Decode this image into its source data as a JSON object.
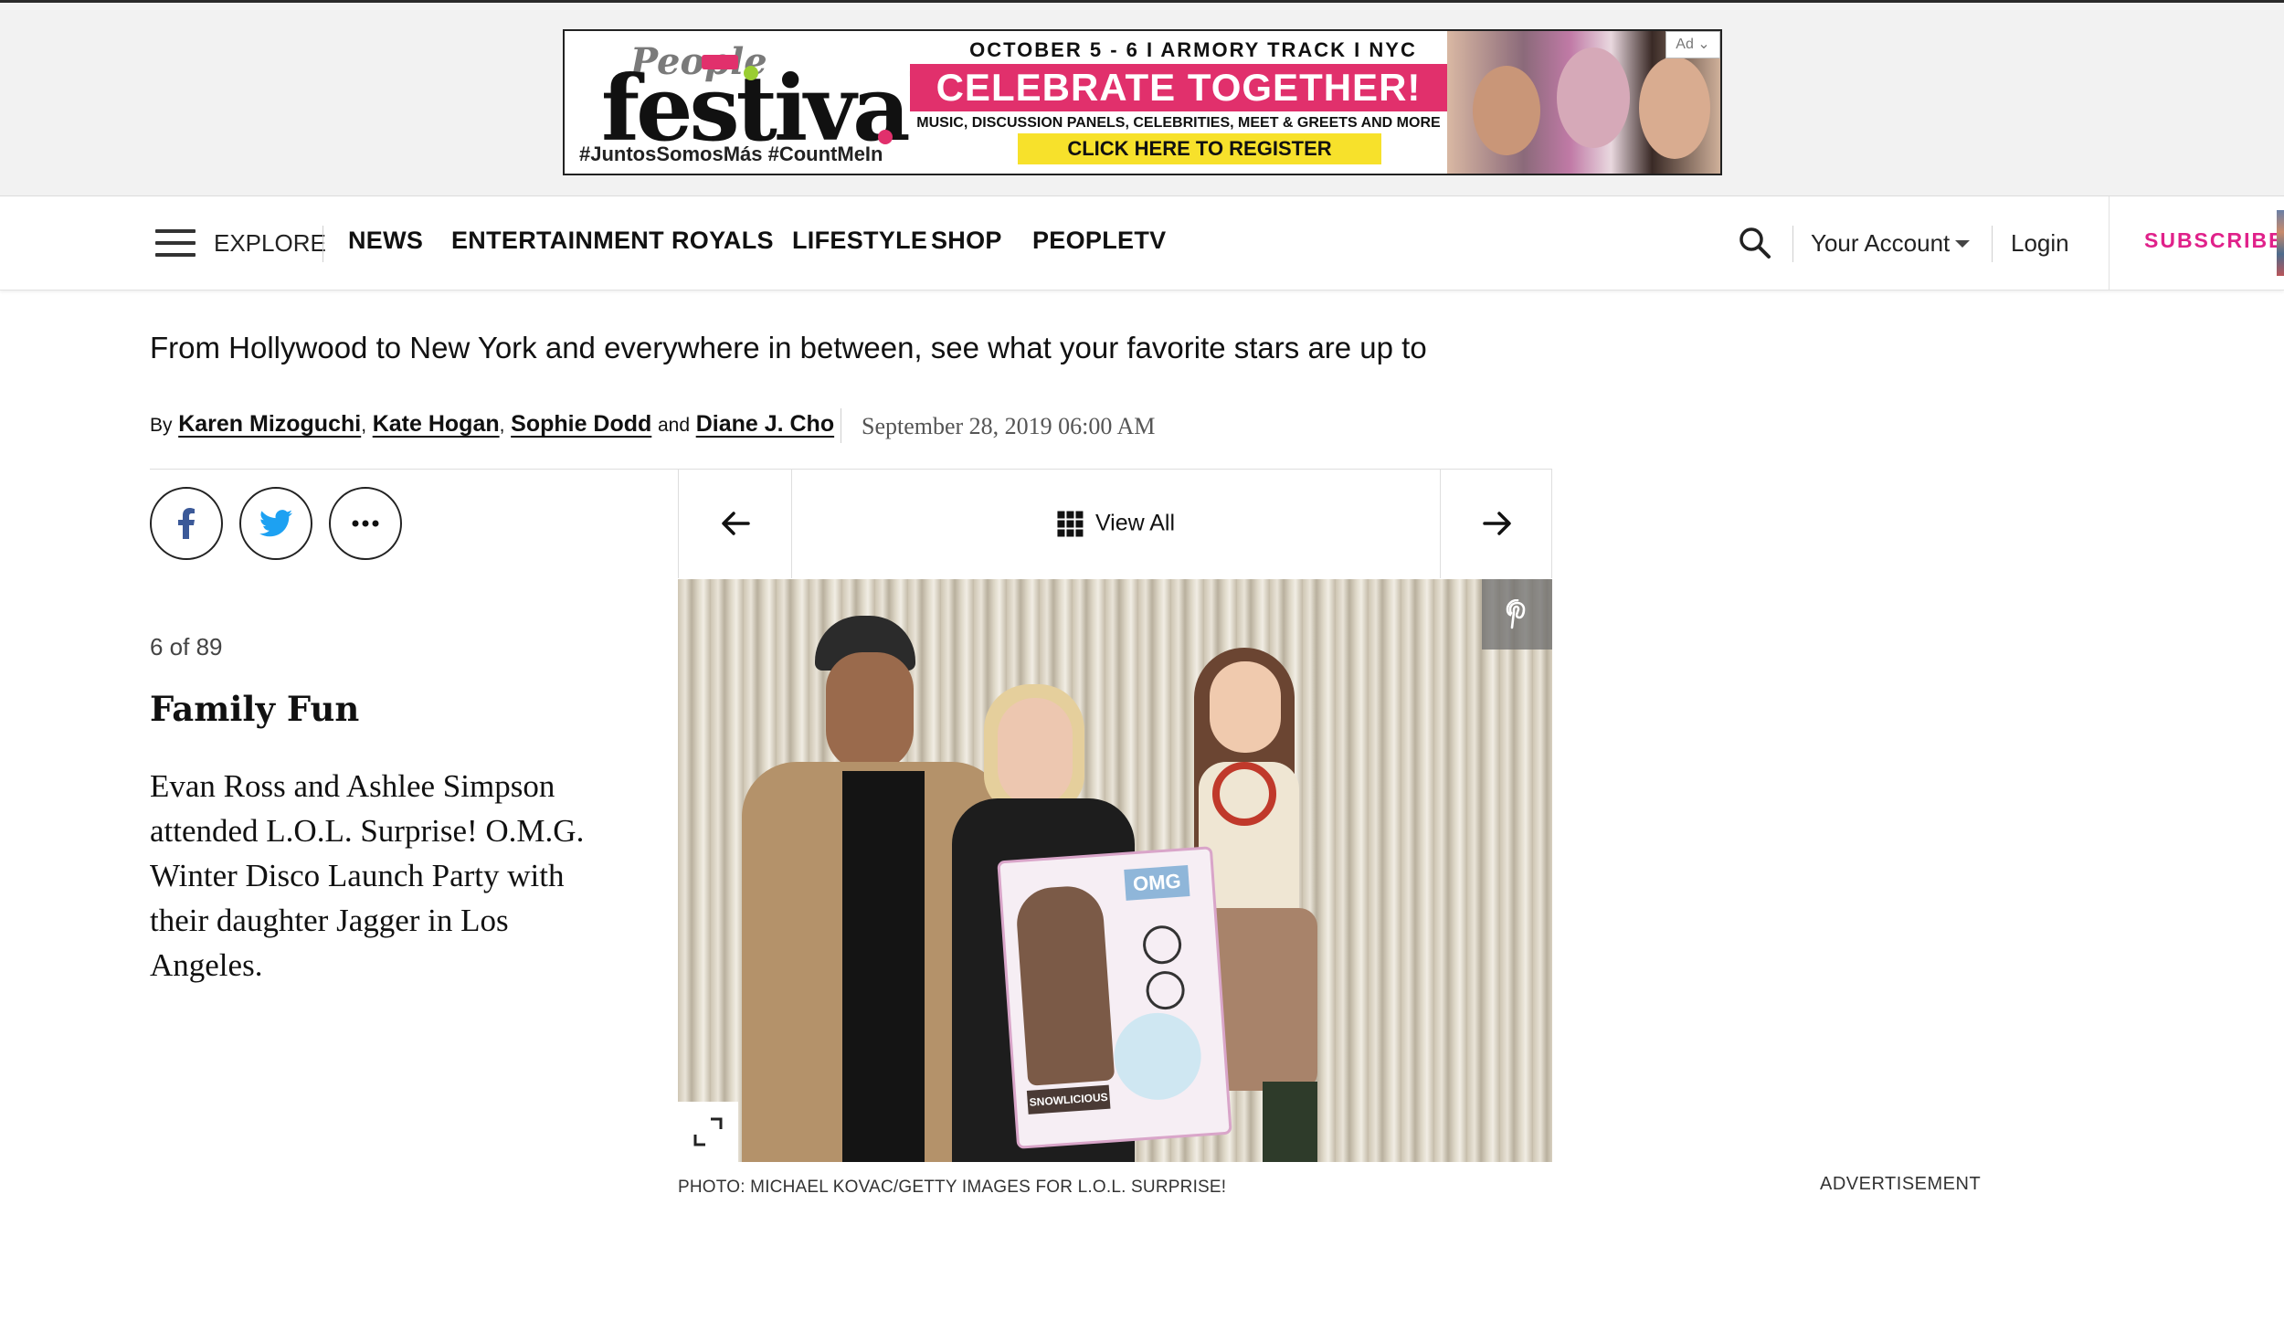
{
  "ad": {
    "tag": "Ad",
    "people": "People",
    "festival": "festival",
    "hashtags": "#JuntosSomosMás #CountMeIn",
    "date_line": "OCTOBER 5 - 6 I ARMORY TRACK I NYC",
    "headline": "CELEBRATE TOGETHER!",
    "subline": "MUSIC, DISCUSSION PANELS, CELEBRITIES, MEET & GREETS AND MORE",
    "cta": "CLICK HERE TO REGISTER",
    "colors": {
      "pink": "#e1306c",
      "yellow": "#f7e12b"
    }
  },
  "nav": {
    "explore": "EXPLORE",
    "links": [
      "NEWS",
      "ENTERTAINMENT",
      "ROYALS",
      "LIFESTYLE",
      "SHOP",
      "PEOPLETV"
    ],
    "account": "Your Account",
    "login": "Login",
    "subscribe": "SUBSCRIBE",
    "subscribe_color": "#e0218a"
  },
  "article": {
    "dek": "From Hollywood to New York and everywhere in between, see what your favorite stars are up to",
    "byline": {
      "by": "By",
      "authors": [
        "Karen Mizoguchi",
        "Kate Hogan",
        "Sophie Dodd",
        "Diane J. Cho"
      ],
      "comma": ",",
      "and": "and"
    },
    "date": "September 28, 2019 06:00 AM"
  },
  "share": {
    "icons": [
      "facebook-icon",
      "twitter-icon",
      "more-icon"
    ]
  },
  "gallery": {
    "counter": "6 of 89",
    "title": "Family Fun",
    "caption": "Evan Ross and Ashlee Simpson attended L.O.L. Surprise! O.M.G. Winter Disco Launch Party with their daughter Jagger in Los Angeles.",
    "view_all": "View All",
    "photo_credit": "PHOTO: MICHAEL KOVAC/GETTY IMAGES FOR L.O.L. SURPRISE!",
    "box_label": "OMG",
    "box_name": "SNOWLICIOUS"
  },
  "sidebar": {
    "advertisement": "ADVERTISEMENT"
  }
}
